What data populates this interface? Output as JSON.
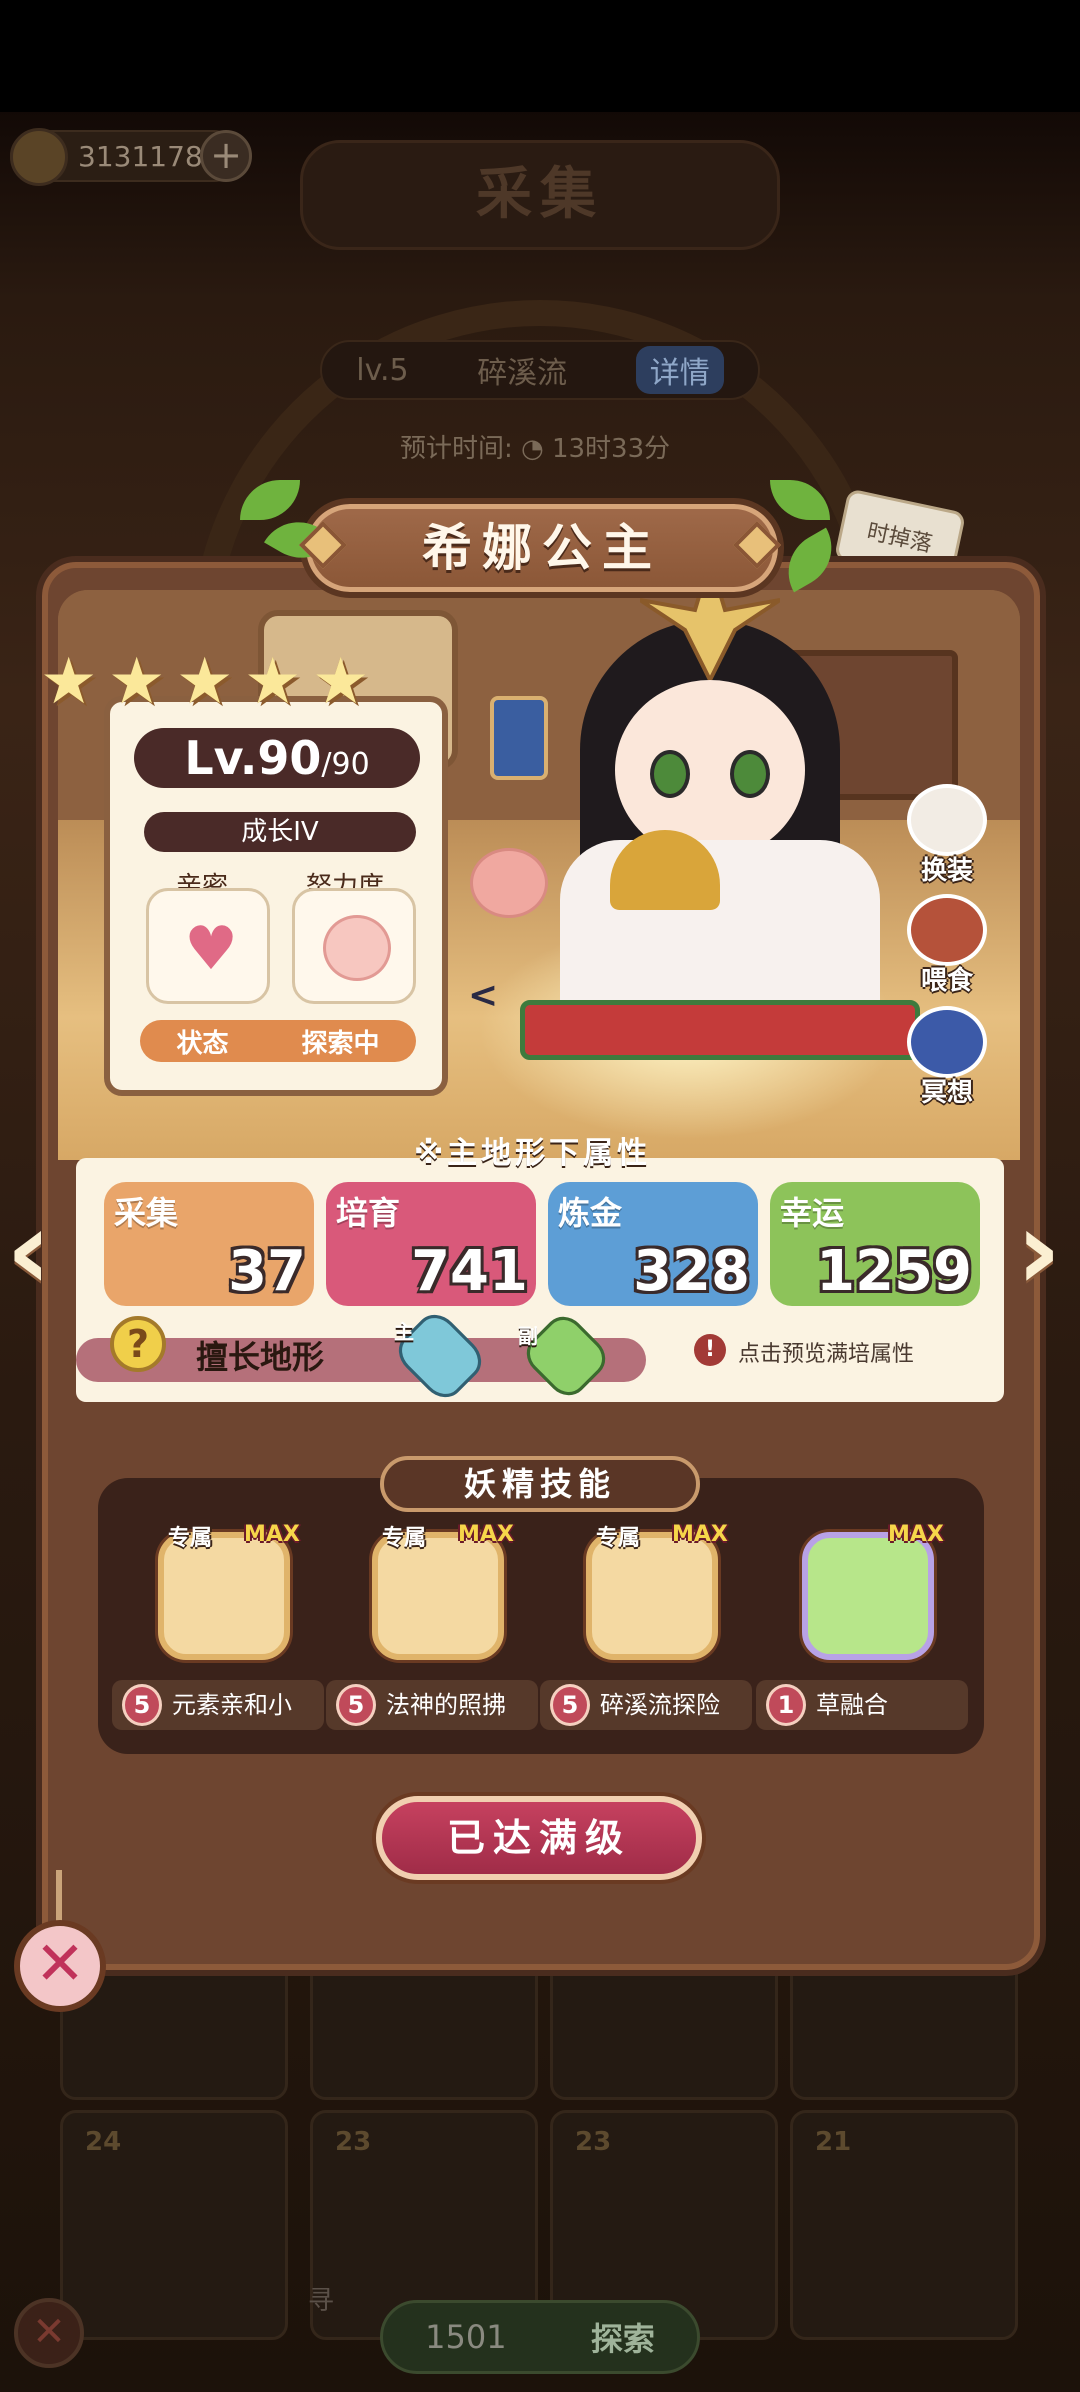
{
  "background": {
    "coins": "3131178",
    "title": "采集",
    "level": "lv.5",
    "location": "碎溪流",
    "detail_label": "详情",
    "time_label": "预计时间: ◔ 13时33分",
    "drop_tag": "时掉落",
    "card_levels": [
      "24",
      "23",
      "23",
      "21"
    ],
    "explore_cost": "1501",
    "explore_label": "探索",
    "search_hint": "寻"
  },
  "character": {
    "name": "希娜公主",
    "stars": 5,
    "level": "Lv.90",
    "level_max": "/90",
    "growth": "成长IV",
    "intimacy_label": "亲密",
    "effort_label": "努力度",
    "state_label": "状态",
    "state_value": "探索中"
  },
  "actions": {
    "outfit": "换装",
    "feed": "喂食",
    "meditate": "冥想"
  },
  "attributes": {
    "title": "※主地形下属性",
    "stats": [
      {
        "name": "采集",
        "value": "37",
        "color": "#e9a56a"
      },
      {
        "name": "培育",
        "value": "741",
        "color": "#d9597a"
      },
      {
        "name": "炼金",
        "value": "328",
        "color": "#5d9ed6"
      },
      {
        "name": "幸运",
        "value": "1259",
        "color": "#8dc35a"
      }
    ],
    "terrain_label": "擅长地形",
    "main_caption": "主",
    "sub_caption": "副",
    "preview_hint": "点击预览满培属性"
  },
  "skills": {
    "title": "妖精技能",
    "exclusive_label": "专属",
    "max_label": "MAX",
    "items": [
      {
        "level": "5",
        "name": "元素亲和小"
      },
      {
        "level": "5",
        "name": "法神的照拂"
      },
      {
        "level": "5",
        "name": "碎溪流探险"
      },
      {
        "level": "1",
        "name": "草融合"
      }
    ]
  },
  "max_level_button": "已达满级"
}
